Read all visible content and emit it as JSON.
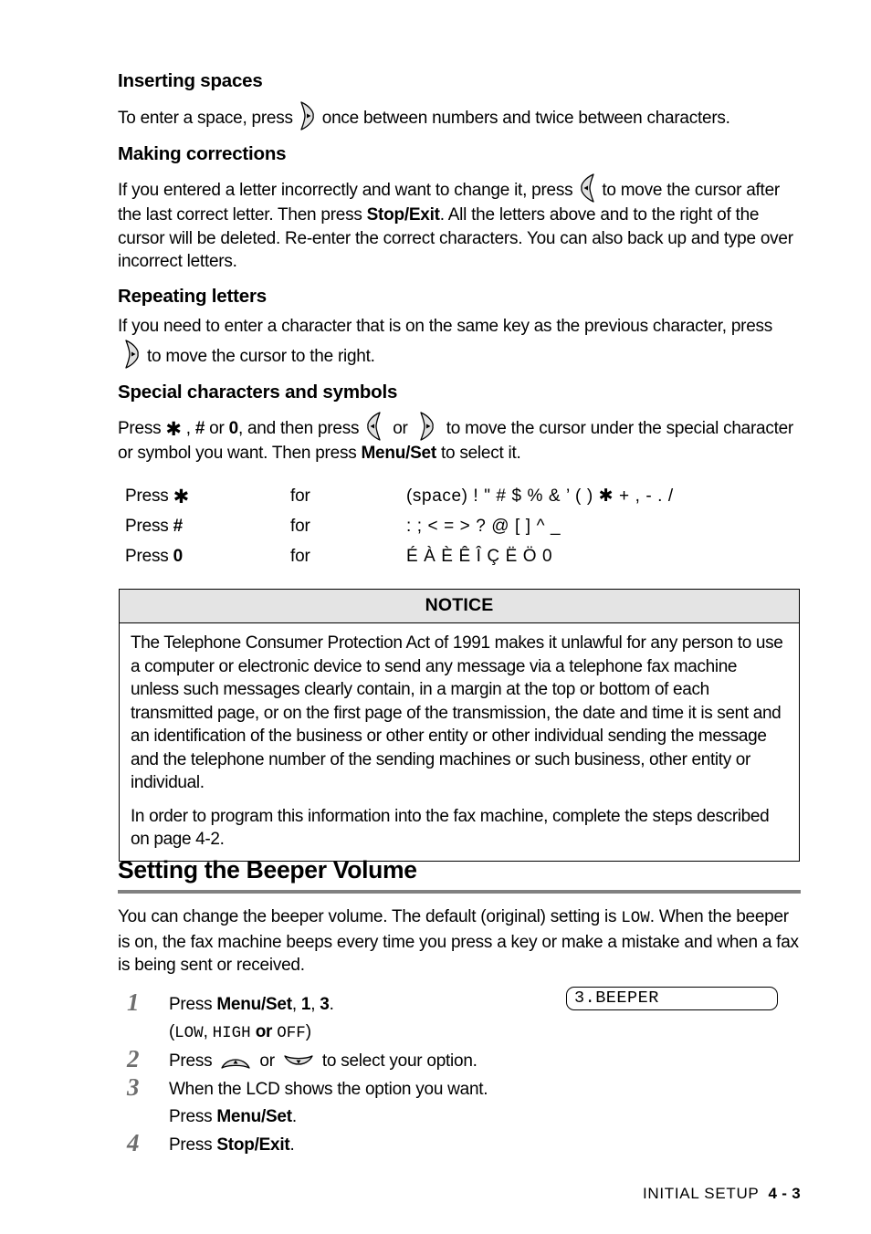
{
  "sections": {
    "inserting_spaces": {
      "heading": "Inserting spaces",
      "text_before": "To enter a space, press",
      "text_after": "once between numbers and twice between characters."
    },
    "making_corrections": {
      "heading": "Making corrections",
      "t1": "If you entered a letter incorrectly and want to change it, press",
      "t2": "to move the cursor after the last correct letter. Then press",
      "bold1": "Stop/Exit",
      "t3": ". All the letters above and to the right of the cursor will be deleted. Re-enter the correct characters. You can also back up and type over incorrect letters."
    },
    "repeating_letters": {
      "heading": "Repeating letters",
      "t1": "If you need to enter a character that is on the same key as the previous character, press",
      "t2": "to move the cursor to the right."
    },
    "special_characters": {
      "heading": "Special characters and symbols",
      "t1": "Press",
      "star": "✱",
      "t2": ",",
      "bold_hash": "#",
      "t3": "or",
      "bold_zero": "0",
      "t4": ", and then press",
      "t5": "or",
      "t6": "to move the cursor under the special character or symbol you want. Then press",
      "bold_menuset": "Menu/Set",
      "t7": "to select it."
    }
  },
  "char_table": {
    "rows": [
      {
        "press_label": "Press",
        "key": "✱",
        "key_type": "star",
        "for_label": "for",
        "chars": "(space) ! \" # $ % & ’ ( )  ✱  + , - . /"
      },
      {
        "press_label": "Press",
        "key": "#",
        "key_type": "bold",
        "for_label": "for",
        "chars": ": ; < = > ? @ [ ] ^ _"
      },
      {
        "press_label": "Press",
        "key": "0",
        "key_type": "bold",
        "for_label": "for",
        "chars": "É À È Ê Î Ç Ë Ö 0"
      }
    ]
  },
  "notice": {
    "title": "NOTICE",
    "paragraphs": [
      "The Telephone Consumer Protection Act of 1991 makes it unlawful for any person to use a computer or electronic device to send any message via a telephone fax machine unless such messages clearly contain, in a margin at the top or bottom of each transmitted page, or on the first page of the transmission, the date and time it is sent and an identification of the business or other entity or other individual sending the message and the telephone number of the sending machines or such business, other entity or individual.",
      "In order to program this information into the fax machine, complete the steps described on page 4-2."
    ]
  },
  "beeper": {
    "title": "Setting the Beeper Volume",
    "intro_a": "You can change the beeper volume. The default (original) setting is",
    "intro_mono": "LOW",
    "intro_b": ". When the beeper is on, the fax machine beeps every time you press a key or make a mistake and when a fax is being sent or received.",
    "steps": [
      {
        "num": "1",
        "press": "Press",
        "bold": "Menu/Set",
        "rest": ",",
        "arg1": "1",
        "comma": ",",
        "arg2": "3",
        "period": ".",
        "options_open": "(",
        "opt1": "LOW",
        "opt_sep": ",",
        "opt2": "HIGH",
        "opt_or": "or",
        "opt3": "OFF",
        "options_close": ")"
      },
      {
        "num": "2",
        "press": "Press",
        "mid": "or",
        "rest": "to select your option."
      },
      {
        "num": "3",
        "line1": "When the LCD shows the option you want.",
        "line2_press": "Press",
        "line2_bold": "Menu/Set",
        "line2_end": "."
      },
      {
        "num": "4",
        "press": "Press",
        "bold": "Stop/Exit",
        "end": "."
      }
    ],
    "lcd": "3.BEEPER"
  },
  "footer": {
    "chapter": "INITIAL SETUP",
    "page": "4 - 3"
  },
  "colors": {
    "rule": "#808080",
    "notice_header_bg": "#e4e4e4",
    "step_number": "#6e6e6e"
  }
}
